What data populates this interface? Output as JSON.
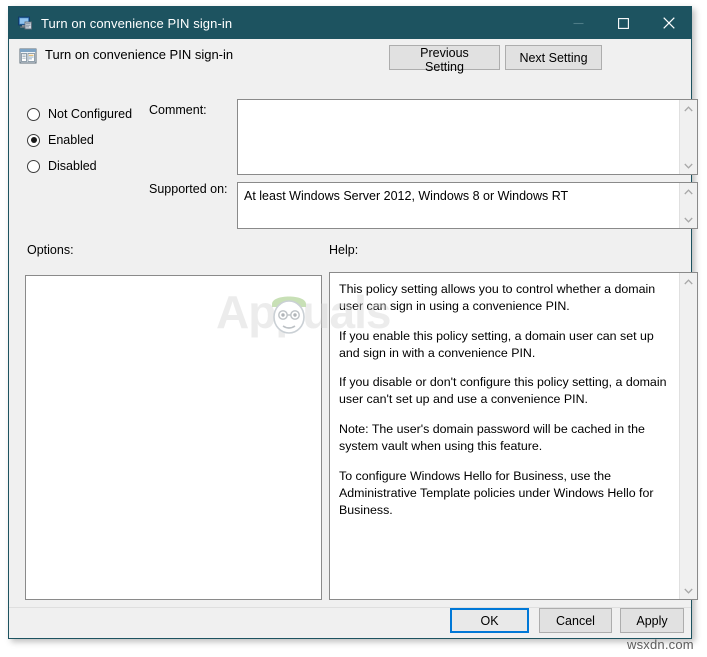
{
  "window": {
    "title": "Turn on convenience PIN sign-in",
    "icon": "computer-policy-icon",
    "controls": {
      "minimize": "minimize-icon",
      "maximize": "maximize-icon",
      "close": "close-icon"
    }
  },
  "header": {
    "icon": "policy-setting-icon",
    "title": "Turn on convenience PIN sign-in",
    "previous_setting": "Previous Setting",
    "next_setting": "Next Setting"
  },
  "state_options": [
    {
      "label": "Not Configured",
      "selected": false
    },
    {
      "label": "Enabled",
      "selected": true
    },
    {
      "label": "Disabled",
      "selected": false
    }
  ],
  "comment": {
    "label": "Comment:",
    "value": "",
    "placeholder": ""
  },
  "supported_on": {
    "label": "Supported on:",
    "value": "At least Windows Server 2012, Windows 8 or Windows RT"
  },
  "options": {
    "label": "Options:",
    "value": ""
  },
  "help": {
    "label": "Help:",
    "paragraphs": [
      "This policy setting allows you to control whether a domain user can sign in using a convenience PIN.",
      "If you enable this policy setting, a domain user can set up and sign in with a convenience PIN.",
      "If you disable or don't configure this policy setting, a domain user can't set up and use a convenience PIN.",
      "Note: The user's domain password will be cached in the system vault when using this feature.",
      "To configure Windows Hello for Business, use the Administrative Template policies under Windows Hello for Business."
    ]
  },
  "footer": {
    "ok": "OK",
    "cancel": "Cancel",
    "apply": "Apply"
  },
  "watermarks": {
    "center": "Appuals",
    "corner": "wsxdn.com"
  },
  "colors": {
    "titlebar": "#1d5360",
    "dialog_background": "#f0f0f0",
    "focus_border": "#0078d7",
    "button_face": "#e1e1e1",
    "button_border": "#adadad",
    "text": "#000000"
  },
  "scroll_icons": {
    "up": "chevron-up-icon",
    "down": "chevron-down-icon"
  }
}
